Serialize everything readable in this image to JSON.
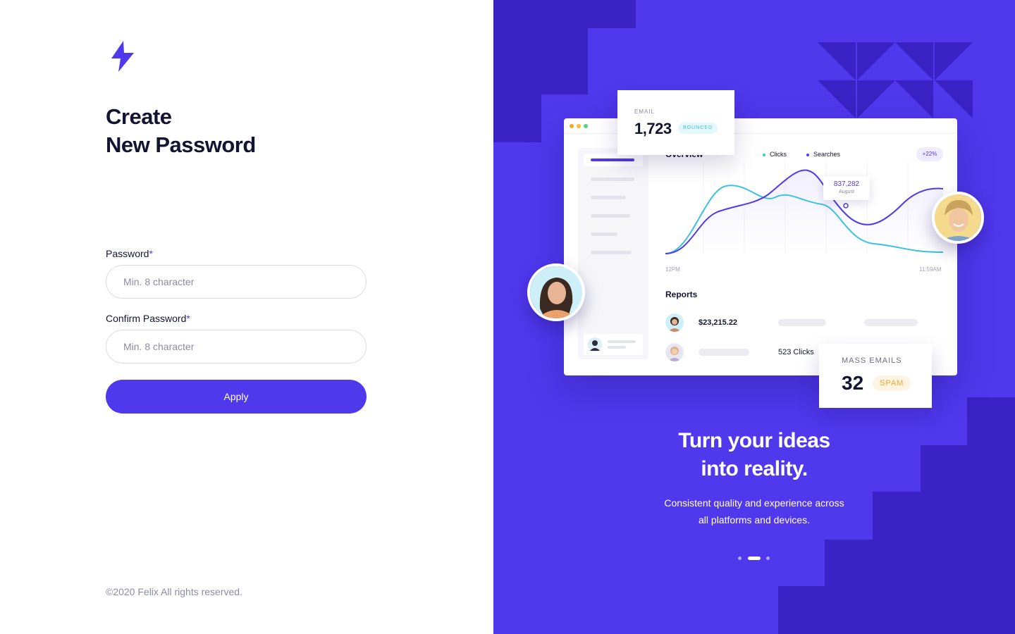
{
  "brand": {
    "accent": "#5038ED",
    "logo_icon": "lightning-bolt-icon"
  },
  "form": {
    "title_line1": "Create",
    "title_line2": "New Password",
    "password_label": "Password",
    "password_placeholder": "Min. 8 character",
    "confirm_label": "Confirm Password",
    "confirm_placeholder": "Min. 8 character",
    "required_mark": "*",
    "apply_label": "Apply"
  },
  "footer": {
    "copyright": "©2020 Felix All rights reserved."
  },
  "showcase": {
    "dashboard": {
      "overview_title": "Overview",
      "legend": [
        "Clicks",
        "Searches"
      ],
      "change_badge": "+22%",
      "tooltip_value": "837,282",
      "tooltip_month": "August",
      "x_start": "12PM",
      "x_end": "11:59AM",
      "reports_title": "Reports",
      "report_amount": "$23,215.22",
      "report_clicks": "523 Clicks"
    },
    "email_card": {
      "label": "EMAIL",
      "value": "1,723",
      "badge": "BOUNCED"
    },
    "mass_card": {
      "label": "MASS EMAILS",
      "value": "32",
      "badge": "SPAM"
    },
    "headline_line1": "Turn your ideas",
    "headline_line2": "into reality.",
    "subline_line1": "Consistent quality and experience across",
    "subline_line2": "all platforms and devices.",
    "carousel": {
      "total": 3,
      "active": 2
    }
  }
}
